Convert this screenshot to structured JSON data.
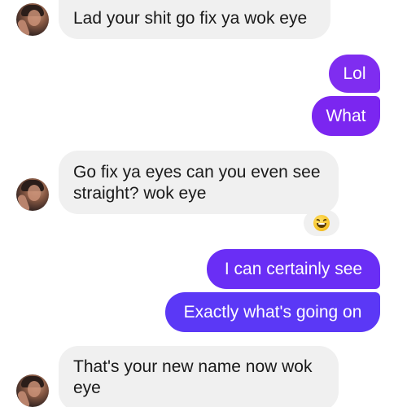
{
  "messages": [
    {
      "sender": "contact",
      "text": "Lad your shit go fix ya wok eye"
    },
    {
      "sender": "me",
      "text": "Lol"
    },
    {
      "sender": "me",
      "text": "What"
    },
    {
      "sender": "contact",
      "line1": "Go fix ya eyes can you even see",
      "line2": "straight? wok eye"
    },
    {
      "sender": "me",
      "text": "I can certainly see"
    },
    {
      "sender": "me",
      "text": "Exactly what's going on"
    },
    {
      "sender": "contact",
      "line1": "That's your new name now wok",
      "line2": "eye"
    }
  ],
  "reaction": {
    "icon": "laughing-emoji-icon"
  },
  "colors": {
    "incoming_bubble": "#f0f0f0",
    "outgoing_bubble": "#7b26f0",
    "outgoing_text": "#ffffff",
    "incoming_text": "#1a1a1a"
  }
}
